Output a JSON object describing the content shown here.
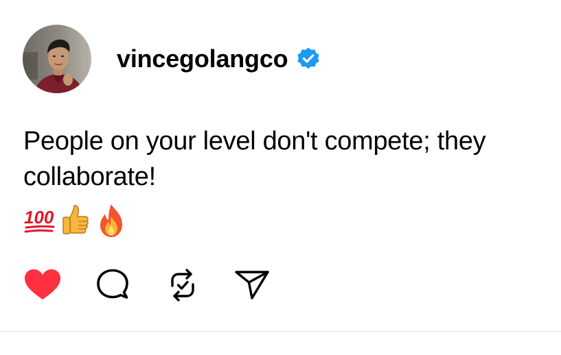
{
  "post": {
    "username": "vincegolangco",
    "verified": true,
    "text": "People on your level don't compete; they collaborate!",
    "emojis": [
      "hundred-points-icon",
      "thumbs-up-icon",
      "fire-icon"
    ],
    "actions": {
      "like": {
        "icon": "heart-icon",
        "liked": true
      },
      "comment": {
        "icon": "comment-bubble-icon"
      },
      "repost": {
        "icon": "repost-icon"
      },
      "share": {
        "icon": "send-icon"
      }
    }
  },
  "colors": {
    "text": "#000000",
    "verified": "#1D9BF0",
    "like": "#FF3040",
    "divider": "#E4E4E4"
  }
}
